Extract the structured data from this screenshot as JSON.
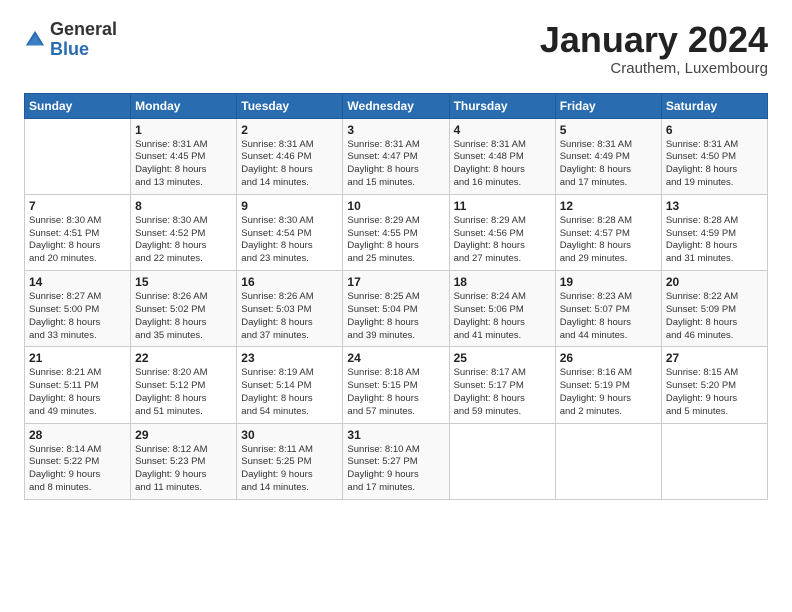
{
  "logo": {
    "general": "General",
    "blue": "Blue"
  },
  "header": {
    "month": "January 2024",
    "location": "Crauthem, Luxembourg"
  },
  "days_of_week": [
    "Sunday",
    "Monday",
    "Tuesday",
    "Wednesday",
    "Thursday",
    "Friday",
    "Saturday"
  ],
  "weeks": [
    [
      {
        "day": "",
        "info": ""
      },
      {
        "day": "1",
        "info": "Sunrise: 8:31 AM\nSunset: 4:45 PM\nDaylight: 8 hours\nand 13 minutes."
      },
      {
        "day": "2",
        "info": "Sunrise: 8:31 AM\nSunset: 4:46 PM\nDaylight: 8 hours\nand 14 minutes."
      },
      {
        "day": "3",
        "info": "Sunrise: 8:31 AM\nSunset: 4:47 PM\nDaylight: 8 hours\nand 15 minutes."
      },
      {
        "day": "4",
        "info": "Sunrise: 8:31 AM\nSunset: 4:48 PM\nDaylight: 8 hours\nand 16 minutes."
      },
      {
        "day": "5",
        "info": "Sunrise: 8:31 AM\nSunset: 4:49 PM\nDaylight: 8 hours\nand 17 minutes."
      },
      {
        "day": "6",
        "info": "Sunrise: 8:31 AM\nSunset: 4:50 PM\nDaylight: 8 hours\nand 19 minutes."
      }
    ],
    [
      {
        "day": "7",
        "info": "Sunrise: 8:30 AM\nSunset: 4:51 PM\nDaylight: 8 hours\nand 20 minutes."
      },
      {
        "day": "8",
        "info": "Sunrise: 8:30 AM\nSunset: 4:52 PM\nDaylight: 8 hours\nand 22 minutes."
      },
      {
        "day": "9",
        "info": "Sunrise: 8:30 AM\nSunset: 4:54 PM\nDaylight: 8 hours\nand 23 minutes."
      },
      {
        "day": "10",
        "info": "Sunrise: 8:29 AM\nSunset: 4:55 PM\nDaylight: 8 hours\nand 25 minutes."
      },
      {
        "day": "11",
        "info": "Sunrise: 8:29 AM\nSunset: 4:56 PM\nDaylight: 8 hours\nand 27 minutes."
      },
      {
        "day": "12",
        "info": "Sunrise: 8:28 AM\nSunset: 4:57 PM\nDaylight: 8 hours\nand 29 minutes."
      },
      {
        "day": "13",
        "info": "Sunrise: 8:28 AM\nSunset: 4:59 PM\nDaylight: 8 hours\nand 31 minutes."
      }
    ],
    [
      {
        "day": "14",
        "info": "Sunrise: 8:27 AM\nSunset: 5:00 PM\nDaylight: 8 hours\nand 33 minutes."
      },
      {
        "day": "15",
        "info": "Sunrise: 8:26 AM\nSunset: 5:02 PM\nDaylight: 8 hours\nand 35 minutes."
      },
      {
        "day": "16",
        "info": "Sunrise: 8:26 AM\nSunset: 5:03 PM\nDaylight: 8 hours\nand 37 minutes."
      },
      {
        "day": "17",
        "info": "Sunrise: 8:25 AM\nSunset: 5:04 PM\nDaylight: 8 hours\nand 39 minutes."
      },
      {
        "day": "18",
        "info": "Sunrise: 8:24 AM\nSunset: 5:06 PM\nDaylight: 8 hours\nand 41 minutes."
      },
      {
        "day": "19",
        "info": "Sunrise: 8:23 AM\nSunset: 5:07 PM\nDaylight: 8 hours\nand 44 minutes."
      },
      {
        "day": "20",
        "info": "Sunrise: 8:22 AM\nSunset: 5:09 PM\nDaylight: 8 hours\nand 46 minutes."
      }
    ],
    [
      {
        "day": "21",
        "info": "Sunrise: 8:21 AM\nSunset: 5:11 PM\nDaylight: 8 hours\nand 49 minutes."
      },
      {
        "day": "22",
        "info": "Sunrise: 8:20 AM\nSunset: 5:12 PM\nDaylight: 8 hours\nand 51 minutes."
      },
      {
        "day": "23",
        "info": "Sunrise: 8:19 AM\nSunset: 5:14 PM\nDaylight: 8 hours\nand 54 minutes."
      },
      {
        "day": "24",
        "info": "Sunrise: 8:18 AM\nSunset: 5:15 PM\nDaylight: 8 hours\nand 57 minutes."
      },
      {
        "day": "25",
        "info": "Sunrise: 8:17 AM\nSunset: 5:17 PM\nDaylight: 8 hours\nand 59 minutes."
      },
      {
        "day": "26",
        "info": "Sunrise: 8:16 AM\nSunset: 5:19 PM\nDaylight: 9 hours\nand 2 minutes."
      },
      {
        "day": "27",
        "info": "Sunrise: 8:15 AM\nSunset: 5:20 PM\nDaylight: 9 hours\nand 5 minutes."
      }
    ],
    [
      {
        "day": "28",
        "info": "Sunrise: 8:14 AM\nSunset: 5:22 PM\nDaylight: 9 hours\nand 8 minutes."
      },
      {
        "day": "29",
        "info": "Sunrise: 8:12 AM\nSunset: 5:23 PM\nDaylight: 9 hours\nand 11 minutes."
      },
      {
        "day": "30",
        "info": "Sunrise: 8:11 AM\nSunset: 5:25 PM\nDaylight: 9 hours\nand 14 minutes."
      },
      {
        "day": "31",
        "info": "Sunrise: 8:10 AM\nSunset: 5:27 PM\nDaylight: 9 hours\nand 17 minutes."
      },
      {
        "day": "",
        "info": ""
      },
      {
        "day": "",
        "info": ""
      },
      {
        "day": "",
        "info": ""
      }
    ]
  ]
}
